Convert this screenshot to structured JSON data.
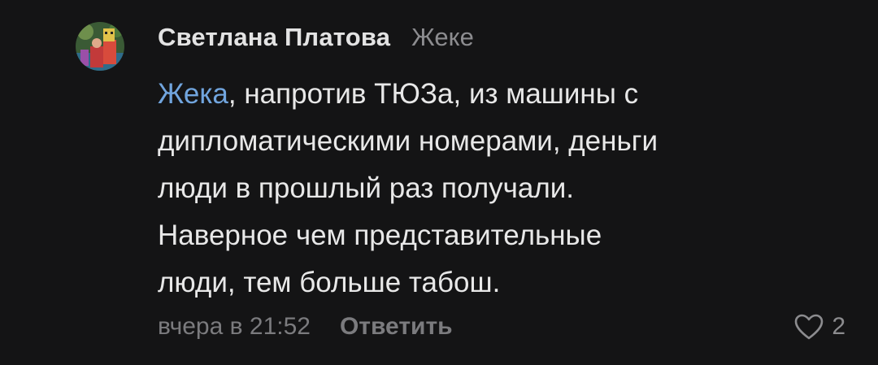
{
  "comment": {
    "author": "Светлана Платова",
    "reply_to": "Жеке",
    "mention": "Жека",
    "text_after_mention": ", напротив ТЮЗа, из машины  с\nдипломатическими номерами, деньги\nлюди в  прошлый раз получали.\nНаверное чем представительные\nлюди, тем больше табош.",
    "date": "вчера в 21:52",
    "reply_label": "Ответить",
    "likes": "2"
  },
  "colors": {
    "background": "#141415",
    "mention": "#71a5de",
    "muted": "#7b7b7e"
  },
  "icons": {
    "avatar": "user-avatar-photo",
    "like": "heart-outline-icon"
  }
}
